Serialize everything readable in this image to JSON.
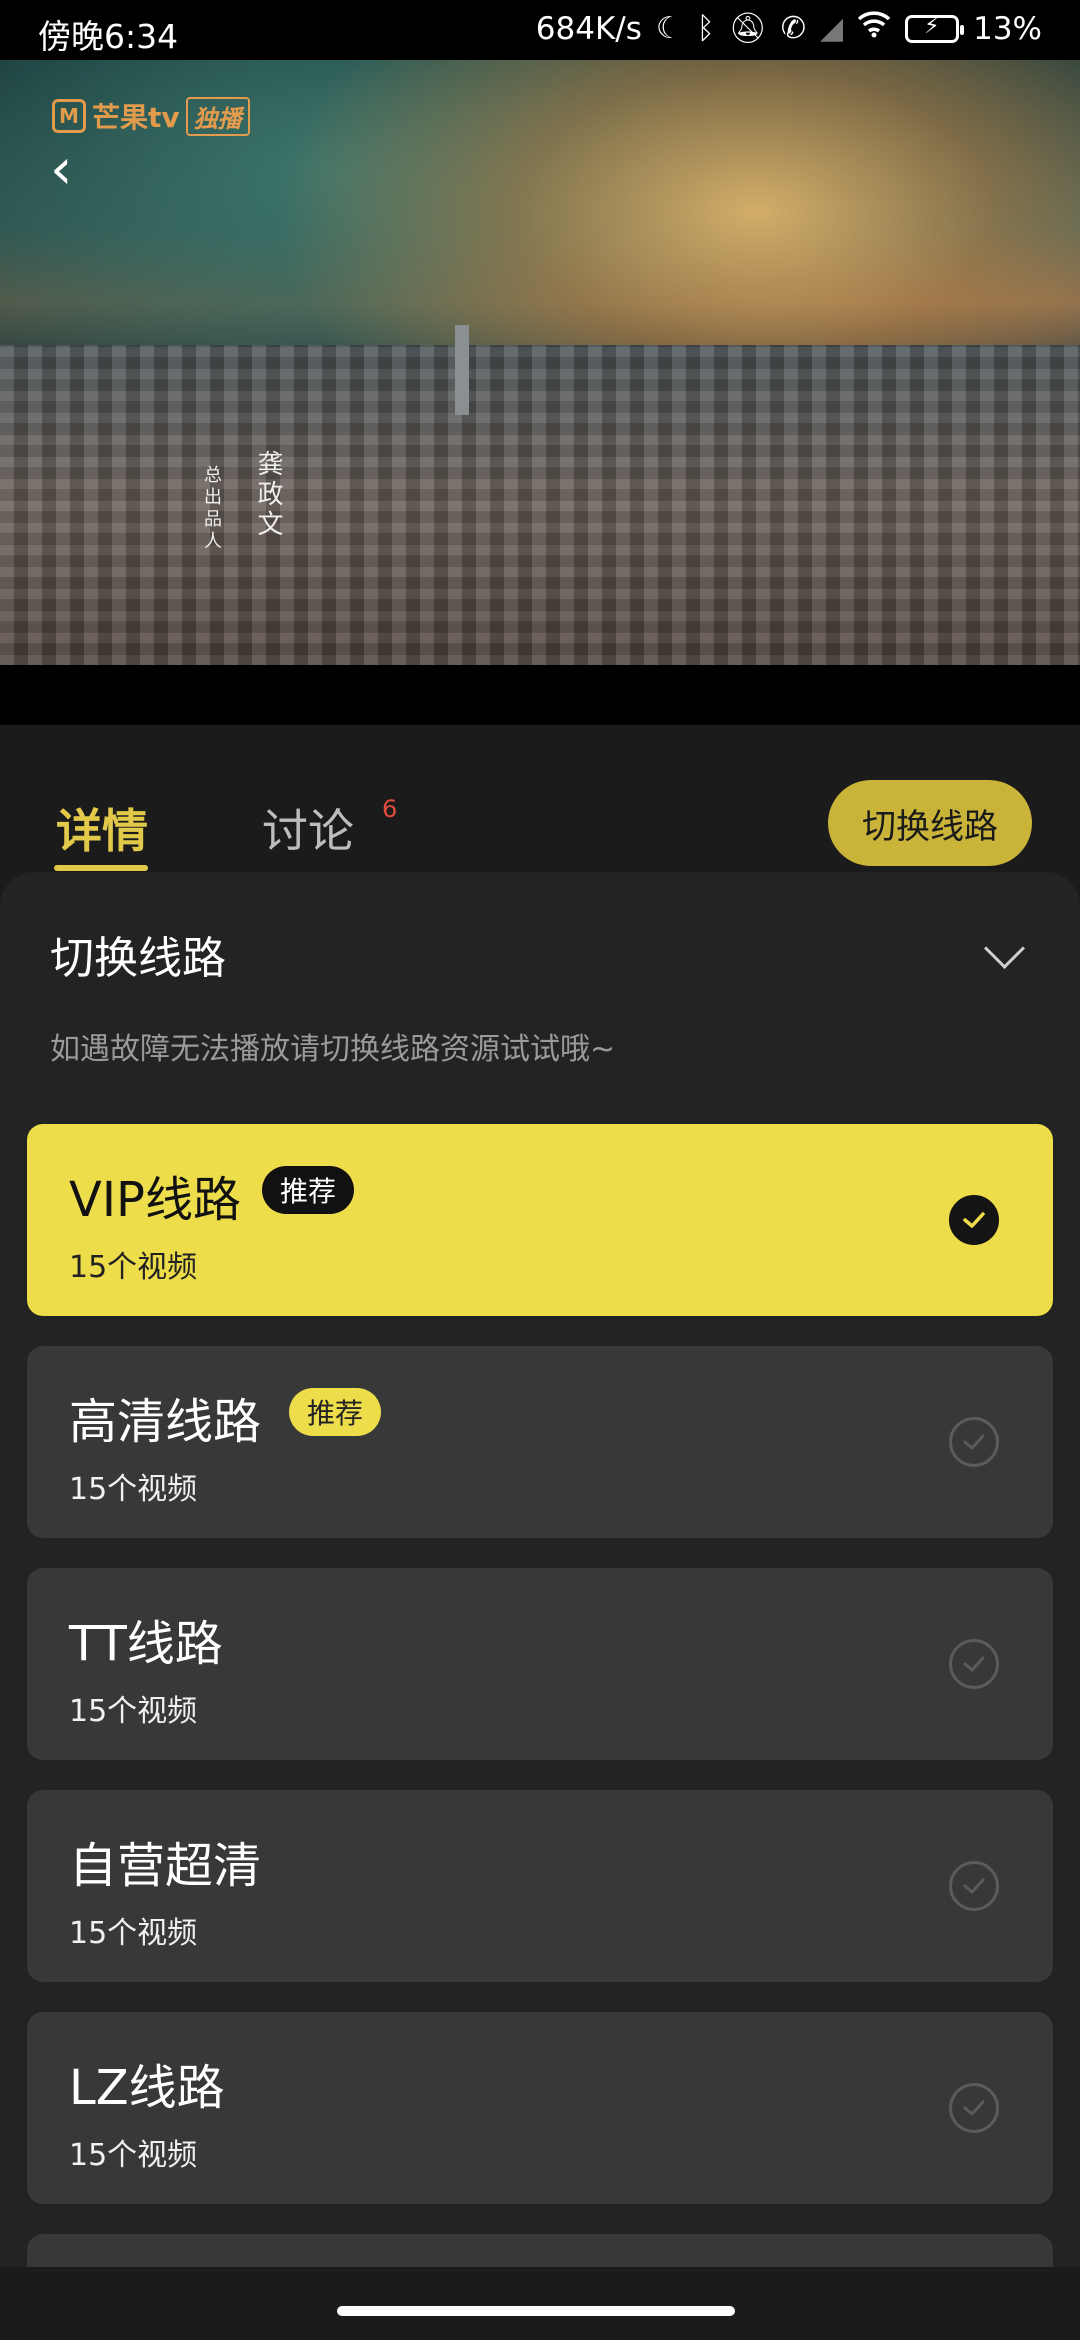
{
  "status_bar": {
    "time": "傍晚6:34",
    "network_speed": "684K/s",
    "battery": "13%",
    "icons": [
      "moon-icon",
      "bluetooth-icon",
      "mute-icon",
      "call-icon",
      "signal-icon",
      "wifi-icon",
      "battery-icon"
    ]
  },
  "video": {
    "logo_text": "芒果tv",
    "logo_badge": "独播",
    "credit_name": "龚政文",
    "credit_role": "总出品人"
  },
  "tabs": [
    {
      "label": "详情"
    },
    {
      "label": "讨论",
      "count": "6"
    }
  ],
  "switch_button": "切换线路",
  "sheet": {
    "title": "切换线路",
    "hint": "如遇故障无法播放请切换线路资源试试哦~",
    "routes": [
      {
        "name": "VIP线路",
        "tag": "推荐",
        "count": "15个视频",
        "selected": true
      },
      {
        "name": "高清线路",
        "tag": "推荐",
        "count": "15个视频",
        "selected": false
      },
      {
        "name": "TT线路",
        "tag": "",
        "count": "15个视频",
        "selected": false
      },
      {
        "name": "自营超清",
        "tag": "",
        "count": "15个视频",
        "selected": false
      },
      {
        "name": "LZ线路",
        "tag": "",
        "count": "15个视频",
        "selected": false
      }
    ]
  },
  "colors": {
    "accent": "#e3c94a",
    "selected_route": "#eedd4a",
    "route_bg": "#383838",
    "sheet_bg": "#232323"
  }
}
